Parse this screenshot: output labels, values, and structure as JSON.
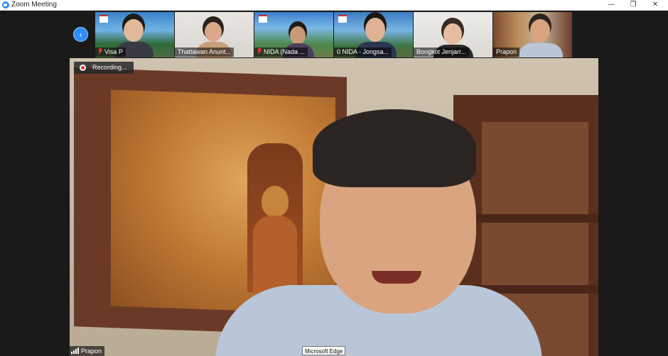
{
  "window": {
    "title": "Zoom Meeting",
    "minimize_icon": "—",
    "restore_icon": "❐",
    "close_icon": "✕"
  },
  "gallery": {
    "scroll_icon": "‹",
    "participants": [
      {
        "name": "Visa P",
        "muted": true
      },
      {
        "name": "Thattawan Anunt...",
        "muted": false
      },
      {
        "name": "NIDA (Nada ...",
        "muted": true
      },
      {
        "name": "0 NIDA - Jongsa...",
        "muted": false
      },
      {
        "name": "Bongkot Jenjarr...",
        "muted": false
      },
      {
        "name": "Prapon",
        "muted": false,
        "active": true
      }
    ]
  },
  "recording": {
    "label": "Recording..."
  },
  "active_speaker": {
    "name": "Prapon"
  },
  "tooltip": {
    "text": "Microsoft Edge"
  },
  "colors": {
    "accent": "#2d8cff",
    "active_border": "#e5f58c",
    "muted": "#e33333"
  }
}
